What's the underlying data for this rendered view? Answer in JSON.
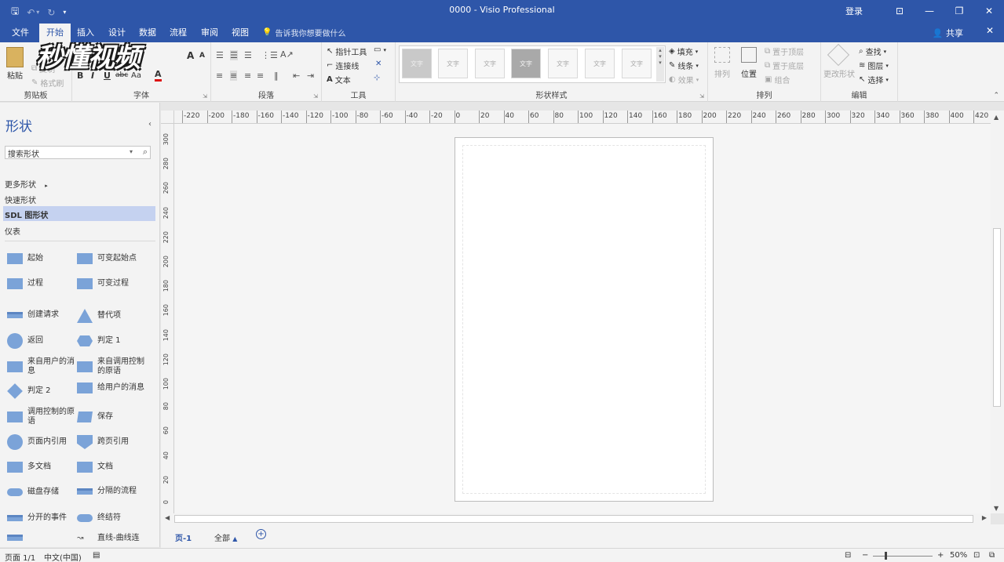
{
  "window": {
    "title": "0000 - Visio Professional",
    "login": "登录",
    "controls": {
      "ribbon_display": "⊡",
      "minimize": "—",
      "maximize": "❐",
      "close": "✕"
    },
    "qat": {
      "save": "🖫",
      "undo": "↶",
      "undo_dd": "▾",
      "redo": "↻",
      "customize": "▾"
    }
  },
  "tabs": [
    {
      "label": "文件"
    },
    {
      "label": "开始"
    },
    {
      "label": "插入"
    },
    {
      "label": "设计"
    },
    {
      "label": "数据"
    },
    {
      "label": "流程"
    },
    {
      "label": "审阅"
    },
    {
      "label": "视图"
    }
  ],
  "tellme": "告诉我你想要做什么",
  "share": "共享",
  "ribbon": {
    "clipboard": {
      "label": "剪贴板",
      "paste": "粘贴",
      "copy": "复制",
      "format_painter": "格式刷"
    },
    "font": {
      "label": "字体",
      "bold": "B",
      "italic": "I",
      "underline": "U",
      "strike": "abc",
      "case": "Aa",
      "color": "A",
      "grow": "A",
      "shrink": "A"
    },
    "paragraph": {
      "label": "段落"
    },
    "tools": {
      "label": "工具",
      "pointer": "指针工具",
      "connector": "连接线",
      "text": "文本"
    },
    "shape_styles": {
      "label": "形状样式",
      "swatch_text": "文字",
      "fill": "填充",
      "line": "线条",
      "effect": "效果"
    },
    "arrange": {
      "label": "排列",
      "arrange": "排列",
      "position": "位置",
      "bring_front": "置于顶层",
      "send_back": "置于底层",
      "group": "组合"
    },
    "editing": {
      "label": "编辑",
      "change_shape": "更改形状",
      "find": "查找",
      "layers": "图层",
      "select": "选择"
    }
  },
  "watermark": "秒懂视频",
  "shapes_pane": {
    "title": "形状",
    "search_placeholder": "搜索形状",
    "stencils": [
      {
        "label": "更多形状"
      },
      {
        "label": "快速形状"
      },
      {
        "label": "SDL 图形状"
      },
      {
        "label": "仪表"
      }
    ],
    "items": [
      {
        "label": "起始"
      },
      {
        "label": "可变起始点"
      },
      {
        "label": "过程"
      },
      {
        "label": "可变过程"
      },
      {
        "label": "创建请求"
      },
      {
        "label": "替代项"
      },
      {
        "label": "返回"
      },
      {
        "label": "判定 1"
      },
      {
        "label": "来自用户的消息"
      },
      {
        "label": "来自调用控制的原语"
      },
      {
        "label": "判定 2"
      },
      {
        "label": "给用户的消息"
      },
      {
        "label": "调用控制的原语"
      },
      {
        "label": "保存"
      },
      {
        "label": "页面内引用"
      },
      {
        "label": "跨页引用"
      },
      {
        "label": "多文档"
      },
      {
        "label": "文档"
      },
      {
        "label": "磁盘存储"
      },
      {
        "label": "分隔的流程"
      },
      {
        "label": "分开的事件"
      },
      {
        "label": "终结符"
      },
      {
        "label": ""
      },
      {
        "label": "直线-曲线连"
      }
    ]
  },
  "hruler_ticks": [
    "-220",
    "-200",
    "-180",
    "-160",
    "-140",
    "-120",
    "-100",
    "-80",
    "-60",
    "-40",
    "-20",
    "0",
    "20",
    "40",
    "60",
    "80",
    "100",
    "120",
    "140",
    "160",
    "180",
    "200",
    "220",
    "240",
    "260",
    "280",
    "300",
    "320",
    "340",
    "360",
    "380",
    "400",
    "420"
  ],
  "vruler_ticks": [
    "300",
    "280",
    "260",
    "240",
    "220",
    "200",
    "180",
    "160",
    "140",
    "120",
    "100",
    "80",
    "60",
    "40",
    "20",
    "0"
  ],
  "page_tabs": {
    "page1": "页-1",
    "all": "全部",
    "add": "+"
  },
  "status": {
    "page": "页面 1/1",
    "language": "中文(中国)",
    "zoom": "50%",
    "zoom_out": "−",
    "zoom_in": "+"
  }
}
